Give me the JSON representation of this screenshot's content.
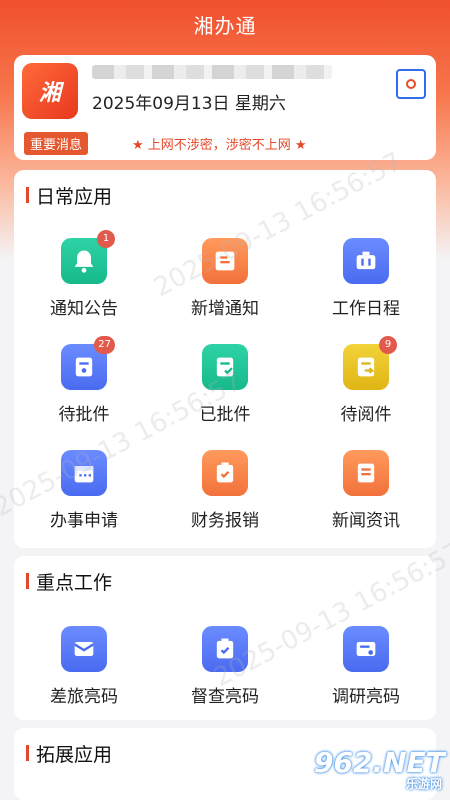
{
  "header": {
    "title": "湘办通"
  },
  "user": {
    "logo_text": "湘",
    "date": "2025年09月13日 星期六"
  },
  "notice": {
    "badge": "重要消息",
    "text": "★ 上网不涉密，涉密不上网 ★"
  },
  "sections": {
    "daily": {
      "title": "日常应用",
      "items": [
        {
          "label": "通知公告",
          "badge": "1"
        },
        {
          "label": "新增通知",
          "badge": ""
        },
        {
          "label": "工作日程",
          "badge": ""
        },
        {
          "label": "待批件",
          "badge": "27"
        },
        {
          "label": "已批件",
          "badge": ""
        },
        {
          "label": "待阅件",
          "badge": "9"
        },
        {
          "label": "办事申请",
          "badge": ""
        },
        {
          "label": "财务报销",
          "badge": ""
        },
        {
          "label": "新闻资讯",
          "badge": ""
        }
      ]
    },
    "key": {
      "title": "重点工作",
      "items": [
        {
          "label": "差旅亮码"
        },
        {
          "label": "督查亮码"
        },
        {
          "label": "调研亮码"
        }
      ]
    },
    "extend": {
      "title": "拓展应用"
    }
  },
  "watermark": "2025-09-13 16:56:57",
  "site_badge": {
    "main": "962.NET",
    "sub": "乐游网"
  },
  "colors": {
    "accent": "#e5472a",
    "header_bg": "#f0502e"
  }
}
